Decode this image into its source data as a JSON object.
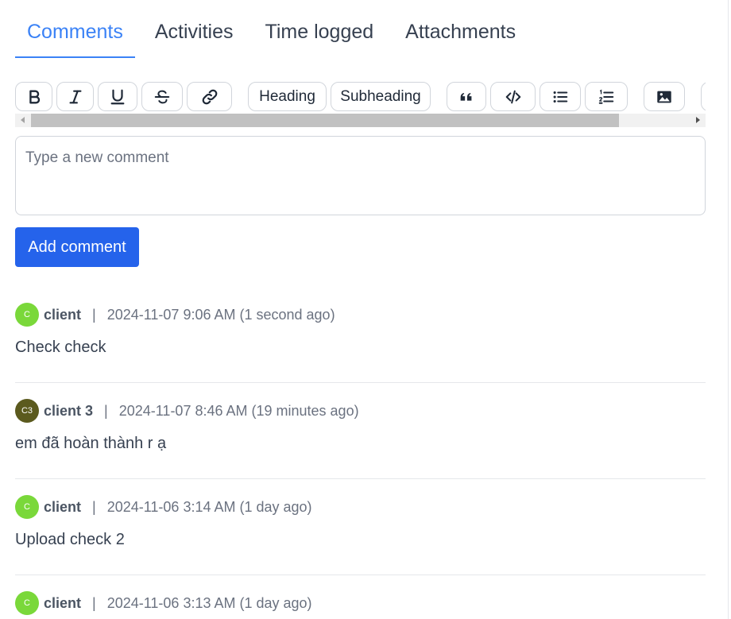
{
  "tabs": [
    {
      "label": "Comments",
      "active": true
    },
    {
      "label": "Activities",
      "active": false
    },
    {
      "label": "Time logged",
      "active": false
    },
    {
      "label": "Attachments",
      "active": false
    }
  ],
  "toolbar": {
    "heading_label": "Heading",
    "subheading_label": "Subheading",
    "icons": [
      "bold-icon",
      "italic-icon",
      "underline-icon",
      "strikethrough-icon",
      "link-icon",
      "quote-icon",
      "code-icon",
      "bullet-list-icon",
      "numbered-list-icon",
      "image-icon"
    ]
  },
  "comment_input": {
    "placeholder": "Type a new comment",
    "value": ""
  },
  "add_comment_label": "Add comment",
  "colors": {
    "accent": "#3b82f6",
    "button": "#2563eb",
    "avatar_green": "#7ad83a",
    "avatar_olive": "#5b5a1e"
  },
  "comments": [
    {
      "initials": "C",
      "author": "client",
      "separator": "|",
      "time": "2024-11-07 9:06 AM (1 second ago)",
      "text": "Check check"
    },
    {
      "initials": "C3",
      "author": "client 3",
      "separator": "|",
      "time": "2024-11-07 8:46 AM (19 minutes ago)",
      "text": "em đã hoàn thành r ạ"
    },
    {
      "initials": "C",
      "author": "client",
      "separator": "|",
      "time": "2024-11-06 3:14 AM (1 day ago)",
      "text": "Upload check 2"
    },
    {
      "initials": "C",
      "author": "client",
      "separator": "|",
      "time": "2024-11-06 3:13 AM (1 day ago)",
      "text": ""
    }
  ]
}
